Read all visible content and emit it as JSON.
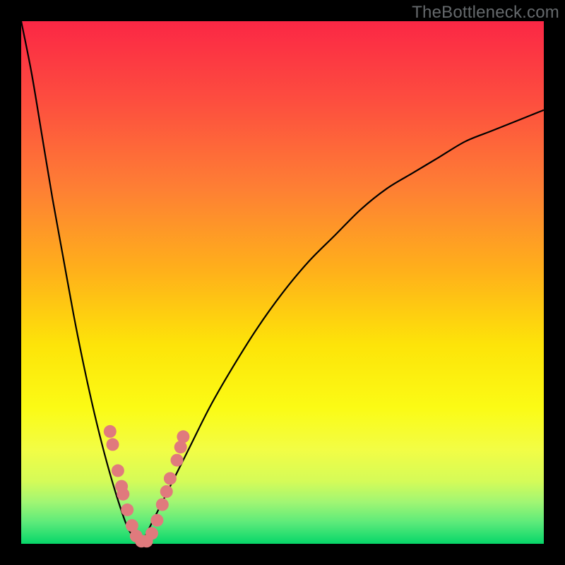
{
  "watermark": {
    "text": "TheBottleneck.com"
  },
  "chart_data": {
    "type": "line",
    "title": "",
    "xlabel": "",
    "ylabel": "",
    "xlim": [
      0,
      100
    ],
    "ylim": [
      0,
      100
    ],
    "grid": false,
    "legend": false,
    "series": [
      {
        "name": "bottleneck-curve-left",
        "x": [
          0,
          2,
          4,
          6,
          8,
          10,
          12,
          14,
          16,
          18,
          20,
          21,
          22,
          23
        ],
        "values": [
          100,
          90,
          78,
          66,
          55,
          44,
          34,
          25,
          17,
          10,
          4,
          2,
          1,
          0
        ]
      },
      {
        "name": "bottleneck-curve-right",
        "x": [
          23,
          25,
          28,
          32,
          36,
          40,
          45,
          50,
          55,
          60,
          65,
          70,
          75,
          80,
          85,
          90,
          95,
          100
        ],
        "values": [
          0,
          4,
          10,
          18,
          26,
          33,
          41,
          48,
          54,
          59,
          64,
          68,
          71,
          74,
          77,
          79,
          81,
          83
        ]
      }
    ],
    "markers": {
      "name": "highlighted-range",
      "color": "#e07a7d",
      "points": [
        {
          "x": 17.0,
          "y": 21.5
        },
        {
          "x": 17.5,
          "y": 19.0
        },
        {
          "x": 18.5,
          "y": 14.0
        },
        {
          "x": 19.2,
          "y": 11.0
        },
        {
          "x": 19.5,
          "y": 9.5
        },
        {
          "x": 20.3,
          "y": 6.5
        },
        {
          "x": 21.2,
          "y": 3.5
        },
        {
          "x": 22.0,
          "y": 1.5
        },
        {
          "x": 23.0,
          "y": 0.5
        },
        {
          "x": 24.0,
          "y": 0.5
        },
        {
          "x": 25.0,
          "y": 2.0
        },
        {
          "x": 26.0,
          "y": 4.5
        },
        {
          "x": 27.0,
          "y": 7.5
        },
        {
          "x": 27.8,
          "y": 10.0
        },
        {
          "x": 28.5,
          "y": 12.5
        },
        {
          "x": 29.8,
          "y": 16.0
        },
        {
          "x": 30.5,
          "y": 18.5
        },
        {
          "x": 31.0,
          "y": 20.5
        }
      ]
    },
    "gradient_stops": [
      {
        "pos": 0.0,
        "color": "#fb2745"
      },
      {
        "pos": 0.15,
        "color": "#fd4d3f"
      },
      {
        "pos": 0.32,
        "color": "#fe7f34"
      },
      {
        "pos": 0.48,
        "color": "#ffb11a"
      },
      {
        "pos": 0.62,
        "color": "#fde409"
      },
      {
        "pos": 0.74,
        "color": "#fbfb15"
      },
      {
        "pos": 0.82,
        "color": "#f2fd45"
      },
      {
        "pos": 0.88,
        "color": "#d5fb58"
      },
      {
        "pos": 0.92,
        "color": "#a1f673"
      },
      {
        "pos": 0.96,
        "color": "#5aea7a"
      },
      {
        "pos": 1.0,
        "color": "#07d669"
      }
    ]
  }
}
